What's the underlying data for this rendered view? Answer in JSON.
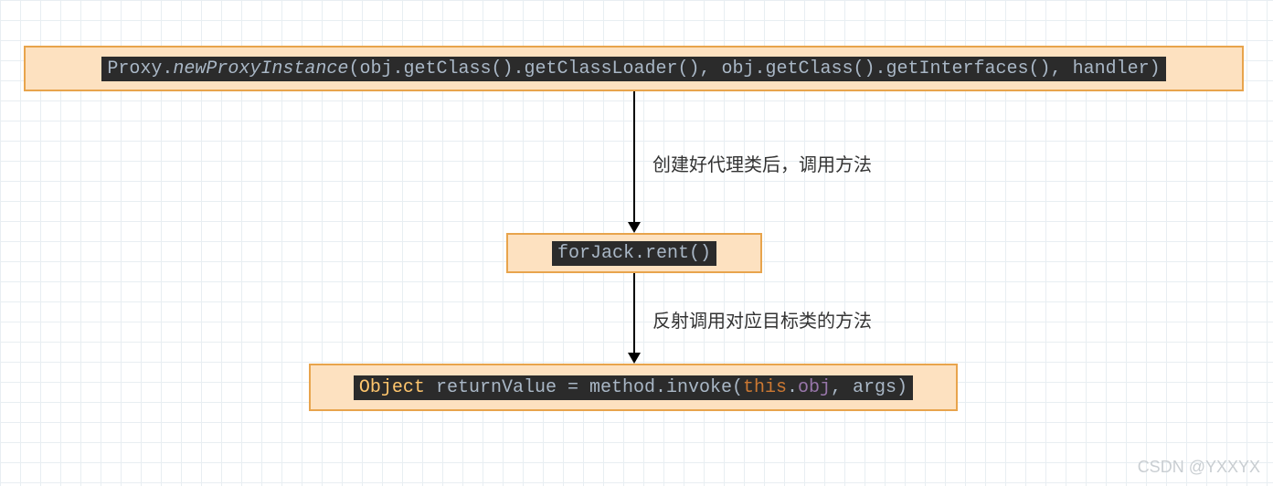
{
  "diagram": {
    "nodes": {
      "n1": {
        "code_tokens": [
          {
            "t": "Proxy.",
            "c": "method"
          },
          {
            "t": "newProxyInstance",
            "c": "kw-italic"
          },
          {
            "t": "(obj.getClass().getClassLoader(), obj.getClass().getInterfaces(), handler)",
            "c": "method"
          }
        ]
      },
      "n2": {
        "code_tokens": [
          {
            "t": "forJack.rent()",
            "c": "method"
          }
        ]
      },
      "n3": {
        "code_tokens": [
          {
            "t": "Object ",
            "c": "fn-yellow"
          },
          {
            "t": "returnValue = method.invoke(",
            "c": "method"
          },
          {
            "t": "this",
            "c": "kw-this"
          },
          {
            "t": ".",
            "c": "method"
          },
          {
            "t": "obj",
            "c": "ident"
          },
          {
            "t": ", args)",
            "c": "method"
          }
        ]
      }
    },
    "edges": {
      "e1": {
        "label": "创建好代理类后，调用方法"
      },
      "e2": {
        "label": "反射调用对应目标类的方法"
      }
    }
  },
  "watermark": "CSDN @YXXYX"
}
